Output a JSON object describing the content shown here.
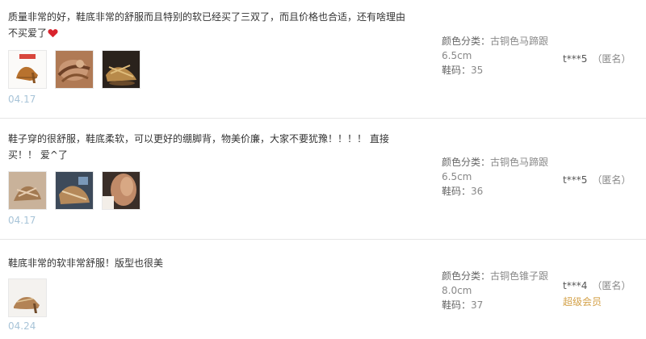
{
  "reviews": [
    {
      "text": "质量非常的好，鞋底非常的舒服而且特别的软已经买了三双了，而且价格也合适，还有啥理由不买爱了",
      "has_heart": true,
      "date": "04.17",
      "color_label": "颜色分类：",
      "color_value_1": "古铜色马蹄跟",
      "color_value_2": "6.5cm",
      "size_label": "鞋码：",
      "size_value": "35",
      "user": "t***5",
      "anon": "（匿名）"
    },
    {
      "text": "鞋子穿的很舒服，鞋底柔软，可以更好的绷脚背，物美价廉，大家不要犹豫！！！！ 直接买！！ 爱^了",
      "has_heart": false,
      "date": "04.17",
      "color_label": "颜色分类：",
      "color_value_1": "古铜色马蹄跟",
      "color_value_2": "6.5cm",
      "size_label": "鞋码：",
      "size_value": "36",
      "user": "t***5",
      "anon": "（匿名）"
    },
    {
      "text": "鞋底非常的软非常舒服！版型也很美",
      "has_heart": false,
      "date": "04.24",
      "color_label": "颜色分类：",
      "color_value_1": "古铜色锥子跟",
      "color_value_2": "8.0cm",
      "size_label": "鞋码：",
      "size_value": "37",
      "user": "t***4",
      "anon": "（匿名）",
      "member": "超级会员"
    }
  ],
  "colors": {
    "heart": "#d9232d",
    "member": "#d4a24a",
    "date": "#a8c4d8"
  }
}
